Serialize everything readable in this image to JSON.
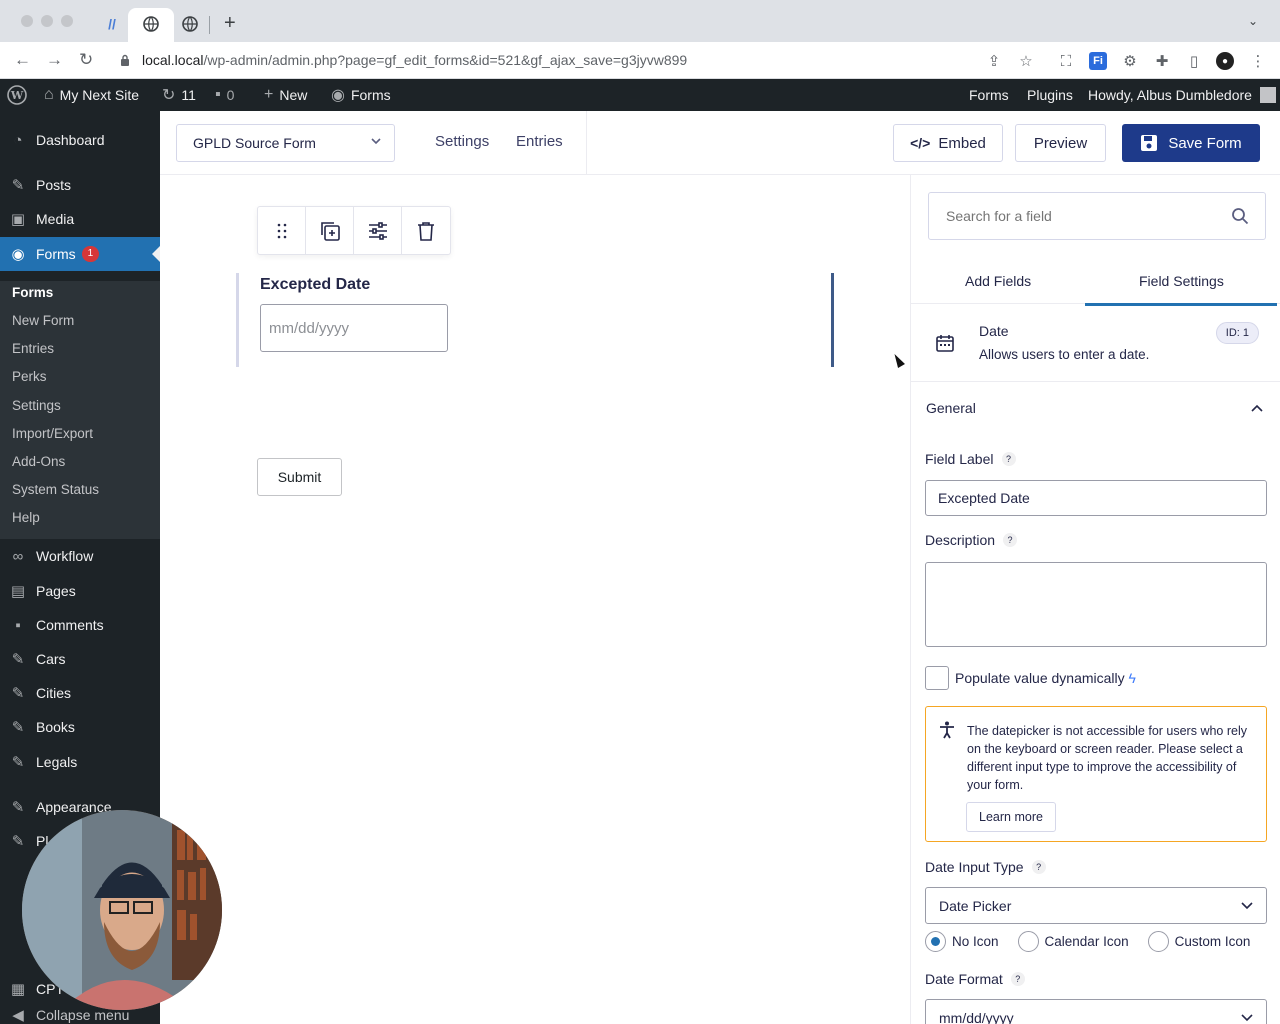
{
  "browser": {
    "url_host": "local.local",
    "url_path": "/wp-admin/admin.php?page=gf_edit_forms&id=521&gf_ajax_save=g3jyvw899"
  },
  "adminbar": {
    "site_name": "My Next Site",
    "updates": "11",
    "comments": "0",
    "new_label": "New",
    "forms_label": "Forms",
    "right_forms": "Forms",
    "right_plugins": "Plugins",
    "howdy": "Howdy, Albus Dumbledore"
  },
  "sidebar": {
    "dashboard": "Dashboard",
    "posts": "Posts",
    "media": "Media",
    "forms": "Forms",
    "forms_badge": "1",
    "sub": [
      "Forms",
      "New Form",
      "Entries",
      "Perks",
      "Settings",
      "Import/Export",
      "Add-Ons",
      "System Status",
      "Help"
    ],
    "workflow": "Workflow",
    "pages": "Pages",
    "comments": "Comments",
    "cars": "Cars",
    "cities": "Cities",
    "books": "Books",
    "legals": "Legals",
    "appearance": "Appearance",
    "plugins_partial": "Pl",
    "cpt_partial": "CPT",
    "collapse": "Collapse menu"
  },
  "toolbar": {
    "form_name": "GPLD Source Form",
    "settings": "Settings",
    "entries": "Entries",
    "embed": "Embed",
    "preview": "Preview",
    "save": "Save Form"
  },
  "canvas": {
    "field_label": "Excepted Date",
    "date_placeholder": "mm/dd/yyyy",
    "submit": "Submit"
  },
  "panel": {
    "search_placeholder": "Search for a field",
    "tab_add": "Add Fields",
    "tab_settings": "Field Settings",
    "field_type": "Date",
    "field_desc": "Allows users to enter a date.",
    "field_id": "ID: 1",
    "section": "General",
    "label_field_label": "Field Label",
    "field_label_value": "Excepted Date",
    "label_description": "Description",
    "populate": "Populate value dynamically",
    "notice": "The datepicker is not accessible for users who rely on the keyboard or screen reader. Please select a different input type to improve the accessibility of your form.",
    "learn_more": "Learn more",
    "label_input_type": "Date Input Type",
    "input_type_value": "Date Picker",
    "radio_options": [
      "No Icon",
      "Calendar Icon",
      "Custom Icon"
    ],
    "label_date_format": "Date Format",
    "date_format_value": "mm/dd/yyyy"
  },
  "colors": {
    "wp_dark": "#1d2327",
    "wp_blue": "#2271b1",
    "save_button": "#1e3a8a",
    "notice_border": "#f5a623"
  }
}
